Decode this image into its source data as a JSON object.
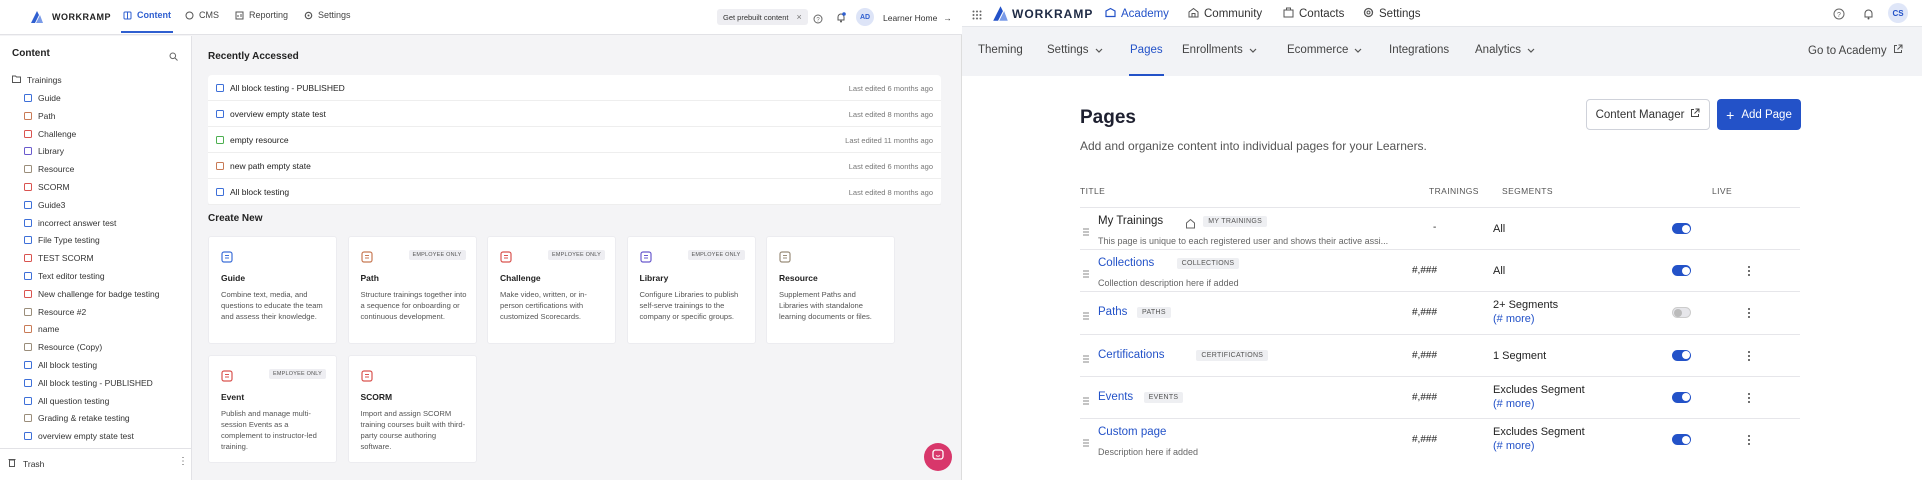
{
  "left_app": {
    "brand": "WORKRAMP",
    "nav": [
      {
        "label": "Content",
        "icon": "book-icon"
      },
      {
        "label": "CMS",
        "icon": "cms-icon"
      },
      {
        "label": "Reporting",
        "icon": "chart-icon"
      },
      {
        "label": "Settings",
        "icon": "gear-icon"
      }
    ],
    "prebuilt_chip": "Get prebuilt content",
    "avatar": "AD",
    "learner_home": "Learner Home",
    "sidebar": {
      "title": "Content",
      "root": "Trainings",
      "items": [
        {
          "label": "Guide",
          "color": "#3d6fd8"
        },
        {
          "label": "Path",
          "color": "#c87a55"
        },
        {
          "label": "Challenge",
          "color": "#d9534f"
        },
        {
          "label": "Library",
          "color": "#6a5acd"
        },
        {
          "label": "Resource",
          "color": "#9a8d7a"
        },
        {
          "label": "SCORM",
          "color": "#d9534f"
        },
        {
          "label": "Guide3",
          "color": "#3d6fd8"
        },
        {
          "label": "incorrect answer test",
          "color": "#3d6fd8"
        },
        {
          "label": "File Type testing",
          "color": "#3d6fd8"
        },
        {
          "label": "TEST SCORM",
          "color": "#d9534f"
        },
        {
          "label": "Text editor testing",
          "color": "#3d6fd8"
        },
        {
          "label": "New challenge for badge testing",
          "color": "#d9534f"
        },
        {
          "label": "Resource #2",
          "color": "#9a8d7a"
        },
        {
          "label": "name",
          "color": "#c87a55"
        },
        {
          "label": "Resource (Copy)",
          "color": "#9a8d7a"
        },
        {
          "label": "All block testing",
          "color": "#3d6fd8"
        },
        {
          "label": "All block testing - PUBLISHED",
          "color": "#3d6fd8"
        },
        {
          "label": "All question testing",
          "color": "#3d6fd8"
        },
        {
          "label": "Grading & retake testing",
          "color": "#9a8d7a"
        },
        {
          "label": "overview empty state test",
          "color": "#3d6fd8"
        }
      ],
      "trash": "Trash"
    },
    "recent": {
      "title": "Recently Accessed",
      "rows": [
        {
          "title": "All block testing - PUBLISHED",
          "time": "Last edited 6 months ago",
          "color": "#3d6fd8"
        },
        {
          "title": "overview empty state test",
          "time": "Last edited 8 months ago",
          "color": "#3d6fd8"
        },
        {
          "title": "empty resource",
          "time": "Last edited 11 months ago",
          "color": "#4caf50"
        },
        {
          "title": "new path empty state",
          "time": "Last edited 6 months ago",
          "color": "#c87a55"
        },
        {
          "title": "All block testing",
          "time": "Last edited 8 months ago",
          "color": "#3d6fd8"
        }
      ]
    },
    "create_new": {
      "title": "Create New",
      "cards": [
        {
          "title": "Guide",
          "badge": "",
          "desc": "Combine text, media, and questions to educate the team and assess their knowledge.",
          "icon": "guide-icon",
          "color": "#3d6fd8"
        },
        {
          "title": "Path",
          "badge": "EMPLOYEE ONLY",
          "desc": "Structure trainings together into a sequence for onboarding or continuous development.",
          "icon": "path-icon",
          "color": "#c87a55"
        },
        {
          "title": "Challenge",
          "badge": "EMPLOYEE ONLY",
          "desc": "Make video, written, or in-person certifications with customized Scorecards.",
          "icon": "flag-icon",
          "color": "#d9534f"
        },
        {
          "title": "Library",
          "badge": "EMPLOYEE ONLY",
          "desc": "Configure Libraries to publish self-serve trainings to the company or specific groups.",
          "icon": "library-icon",
          "color": "#6a5acd"
        },
        {
          "title": "Resource",
          "badge": "",
          "desc": "Supplement Paths and Libraries with standalone learning documents or files.",
          "icon": "resource-icon",
          "color": "#9a8d7a"
        },
        {
          "title": "Event",
          "badge": "EMPLOYEE ONLY",
          "desc": "Publish and manage multi-session Events as a complement to instructor-led training.",
          "icon": "calendar-icon",
          "color": "#d9534f"
        },
        {
          "title": "SCORM",
          "badge": "",
          "desc": "Import and assign SCORM training courses built with third-party course authoring software.",
          "icon": "scorm-icon",
          "color": "#d9534f"
        }
      ]
    }
  },
  "right_app": {
    "brand": "WORKRAMP",
    "nav": [
      {
        "label": "Academy",
        "icon": "academy-icon"
      },
      {
        "label": "Community",
        "icon": "community-icon"
      },
      {
        "label": "Contacts",
        "icon": "contacts-icon"
      },
      {
        "label": "Settings",
        "icon": "gear-icon"
      }
    ],
    "avatar": "CS",
    "subnav": [
      {
        "label": "Theming",
        "dropdown": false
      },
      {
        "label": "Settings",
        "dropdown": true
      },
      {
        "label": "Pages",
        "dropdown": false
      },
      {
        "label": "Enrollments",
        "dropdown": true
      },
      {
        "label": "Ecommerce",
        "dropdown": true
      },
      {
        "label": "Integrations",
        "dropdown": false
      },
      {
        "label": "Analytics",
        "dropdown": true
      }
    ],
    "go_to_academy": "Go to Academy",
    "page_title": "Pages",
    "page_subtitle": "Add and organize content into individual pages for your Learners.",
    "content_manager_btn": "Content Manager",
    "add_page_btn": "Add Page",
    "columns": {
      "title": "TITLE",
      "trainings": "TRAININGS",
      "segments": "SEGMENTS",
      "live": "LIVE"
    },
    "rows": [
      {
        "name": "My Trainings",
        "tag": "MY TRAININGS",
        "desc": "This page is unique to each registered user and shows their active assi...",
        "trainings": "-",
        "seg1": "All",
        "seg2": "",
        "live": true,
        "home": true
      },
      {
        "name": "Collections",
        "tag": "COLLECTIONS",
        "desc": "Collection description here if added",
        "trainings": "#,###",
        "seg1": "All",
        "seg2": "",
        "live": true,
        "home": false
      },
      {
        "name": "Paths",
        "tag": "PATHS",
        "desc": "",
        "trainings": "#,###",
        "seg1": "2+ Segments",
        "seg2": "(# more)",
        "live": false,
        "home": false
      },
      {
        "name": "Certifications",
        "tag": "CERTIFICATIONS",
        "desc": "",
        "trainings": "#,###",
        "seg1": "1 Segment",
        "seg2": "",
        "live": true,
        "home": false
      },
      {
        "name": "Events",
        "tag": "EVENTS",
        "desc": "",
        "trainings": "#,###",
        "seg1": "Excludes Segment",
        "seg2": "(# more)",
        "live": true,
        "home": false
      },
      {
        "name": "Custom page",
        "tag": "",
        "desc": "Description here if added",
        "trainings": "#,###",
        "seg1": "Excludes Segment",
        "seg2": "(# more)",
        "live": true,
        "home": false
      }
    ]
  }
}
